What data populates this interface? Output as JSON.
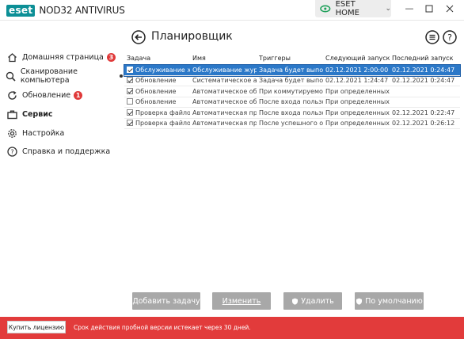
{
  "app": {
    "logo_text": "eset",
    "product_name": "NOD32 ANTIVIRUS",
    "home_button": "ESET HOME"
  },
  "sidebar": {
    "items": [
      {
        "label": "Домашняя страница",
        "badge": "3",
        "icon": "home-icon"
      },
      {
        "label": "Сканирование компьютера",
        "icon": "search-icon"
      },
      {
        "label": "Обновление",
        "badge": "1",
        "icon": "refresh-icon"
      },
      {
        "label": "Сервис",
        "icon": "briefcase-icon"
      },
      {
        "label": "Настройка",
        "icon": "gear-icon"
      },
      {
        "label": "Справка и поддержка",
        "icon": "help-icon"
      }
    ]
  },
  "page": {
    "title": "Планировщик"
  },
  "table": {
    "headers": [
      "Задача",
      "Имя",
      "Триггеры",
      "Следующий запуск",
      "Последний запуск"
    ],
    "rows": [
      {
        "checked": true,
        "task": "Обслуживание ж...",
        "name": "Обслуживание журна...",
        "trigger": "Задача будет выполн...",
        "next": "02.12.2021 2:00:00",
        "last": "02.12.2021 0:24:47",
        "selected": true
      },
      {
        "checked": true,
        "task": "Обновление",
        "name": "Систематическое авт...",
        "trigger": "Задача будет выполн...",
        "next": "02.12.2021 1:24:47",
        "last": "02.12.2021 0:24:47",
        "selected": false
      },
      {
        "checked": true,
        "task": "Обновление",
        "name": "Автоматическое обн...",
        "trigger": "При коммутируемом ...",
        "next": "При определенных ус...",
        "last": "",
        "selected": false
      },
      {
        "checked": false,
        "task": "Обновление",
        "name": "Автоматическое обн...",
        "trigger": "После входа пользова...",
        "next": "При определенных ус...",
        "last": "",
        "selected": false
      },
      {
        "checked": true,
        "task": "Проверка файло...",
        "name": "Автоматическая пров...",
        "trigger": "После входа пользова...",
        "next": "При определенных ус...",
        "last": "02.12.2021 0:22:47",
        "selected": false
      },
      {
        "checked": true,
        "task": "Проверка файло...",
        "name": "Автоматическая пров...",
        "trigger": "После успешного обн...",
        "next": "При определенных ус...",
        "last": "02.12.2021 0:26:12",
        "selected": false
      }
    ]
  },
  "buttons": {
    "add": "Добавить задачу",
    "edit": "Изменить",
    "delete": "Удалить",
    "default": "По умолчанию"
  },
  "footer": {
    "license_button": "Купить лицензию",
    "message": "Срок действия пробной версии истекает через 30 дней."
  },
  "colors": {
    "accent": "#0c8f96",
    "selection": "#2b78c8",
    "footer": "#e23b3b",
    "badge": "#e03a3a",
    "button": "#a8a8a8"
  }
}
